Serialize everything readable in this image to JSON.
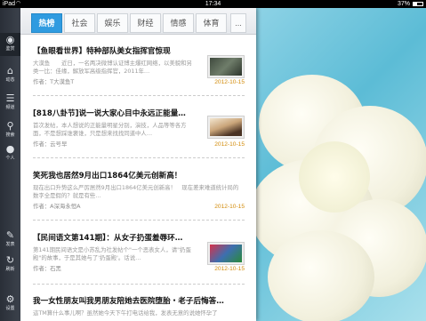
{
  "status_bar": {
    "carrier": "iPad",
    "wifi_icon": "wifi-icon",
    "time": "17:34",
    "battery_percent": "37%",
    "battery_level": 0.37
  },
  "left_nav": {
    "items": [
      {
        "icon": "eye-icon",
        "label": "鉴赏"
      },
      {
        "icon": "home-icon",
        "label": "动态"
      },
      {
        "icon": "list-icon",
        "label": "频道"
      },
      {
        "icon": "search-icon",
        "label": "搜索"
      },
      {
        "icon": "person-icon",
        "label": "个人"
      },
      {
        "icon": "compose-icon",
        "label": "发表"
      },
      {
        "icon": "refresh-icon",
        "label": "刷新"
      },
      {
        "icon": "gear-icon",
        "label": "设置"
      }
    ]
  },
  "tabs": [
    "热榜",
    "社会",
    "娱乐",
    "财经",
    "情感",
    "体育",
    "..."
  ],
  "active_tab": 0,
  "articles": [
    {
      "title": "【鱼眼看世界】特种部队美女指挥官惊现",
      "summary": "大漠鱼　　近日，一名两决微博认证博主爆红网络，以美貌和另类一比：佳缘，解放军高级指挥官，2011年…",
      "author": "作者：T大漠鱼T",
      "date": "2012-10-15"
    },
    {
      "title": "[818八卦节]说一说大家心目中永远正能量…",
      "summary": "首次发帖，本人想说的正能量明星分别，演技，人品等等各方面，不是想踩谁褒谁，只是想来找找同道中人…",
      "author": "作者：云号早",
      "date": "2012-10-15"
    },
    {
      "title": "笑死我也居然9月出口1864亿美元创新高！",
      "summary": "现在出口升势这么严厉居然9月出口1864亿美元创新高！　现在差来难道统计局的数字全是假的？就是有些…",
      "author": "作者：A深海永恒A",
      "date": "2012-10-15"
    },
    {
      "title": "【民间语文第141期】：从女子扔蛋羞辱环…",
      "summary": "第141期民间语文是小苏乱为社发帖个\"一个恶表女人，请\"扔蛋殿\"的故事，于是其她与了'扔蛋殿'。话说…",
      "author": "作者：石黑",
      "date": "2012-10-15"
    },
    {
      "title": "我一女性朋友叫我男朋友陪她去医院堕胎・老子后悔答…",
      "summary": "這TM算什么事儿啊？虽然她今天下午打电话给我，发表无意的说她怀孕了",
      "author": "",
      "date": ""
    }
  ]
}
